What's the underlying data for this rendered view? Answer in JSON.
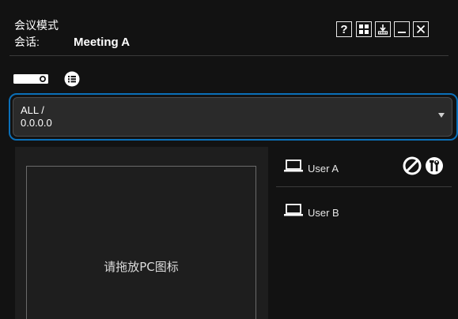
{
  "header": {
    "mode_label": "会议模式",
    "session_key": "会话:",
    "session_value": "Meeting A",
    "help_label": "?"
  },
  "selector": {
    "line1": "ALL /",
    "line2": "0.0.0.0"
  },
  "drop_area": {
    "placeholder": "请拖放PC图标"
  },
  "users": [
    {
      "name": "User A"
    },
    {
      "name": "User B"
    }
  ],
  "colors": {
    "background": "#121212",
    "focus_ring": "#0b6fb8",
    "panel": "#1e1e1e"
  }
}
